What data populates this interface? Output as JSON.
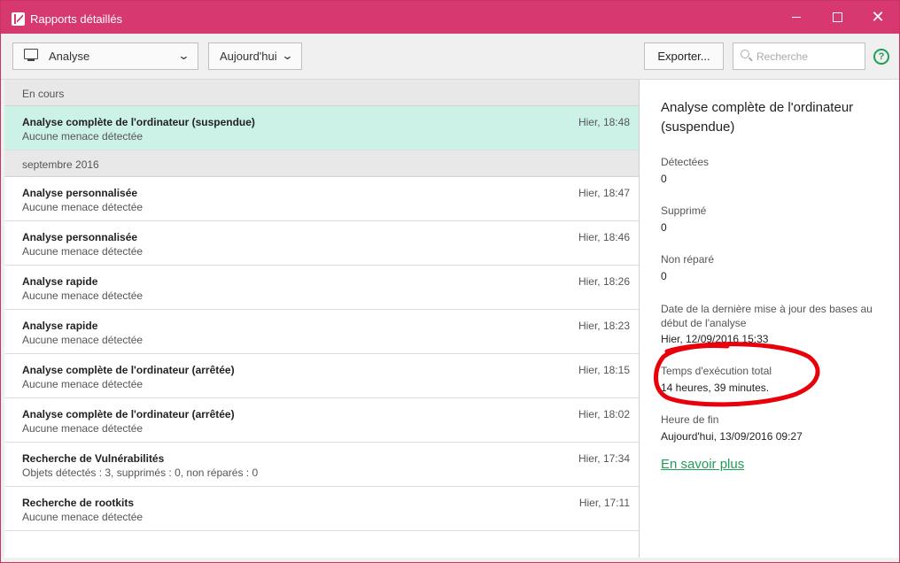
{
  "window": {
    "title": "Rapports détaillés"
  },
  "toolbar": {
    "filter_scope": "Analyse",
    "filter_period": "Aujourd'hui",
    "export_label": "Exporter...",
    "search_placeholder": "Recherche"
  },
  "list": {
    "group1": "En cours",
    "group2": "septembre 2016",
    "items": [
      {
        "name": "Analyse complète de l'ordinateur (suspendue)",
        "status": "Aucune menace détectée",
        "time": "Hier, 18:48"
      },
      {
        "name": "Analyse personnalisée",
        "status": "Aucune menace détectée",
        "time": "Hier, 18:47"
      },
      {
        "name": "Analyse personnalisée",
        "status": "Aucune menace détectée",
        "time": "Hier, 18:46"
      },
      {
        "name": "Analyse rapide",
        "status": "Aucune menace détectée",
        "time": "Hier, 18:26"
      },
      {
        "name": "Analyse rapide",
        "status": "Aucune menace détectée",
        "time": "Hier, 18:23"
      },
      {
        "name": "Analyse complète de l'ordinateur (arrêtée)",
        "status": "Aucune menace détectée",
        "time": "Hier, 18:15"
      },
      {
        "name": "Analyse complète de l'ordinateur (arrêtée)",
        "status": "Aucune menace détectée",
        "time": "Hier, 18:02"
      },
      {
        "name": "Recherche de Vulnérabilités",
        "status": "Objets détectés : 3, supprimés : 0, non réparés : 0",
        "time": "Hier, 17:34"
      },
      {
        "name": "Recherche de rootkits",
        "status": "Aucune menace détectée",
        "time": "Hier, 17:11"
      }
    ]
  },
  "details": {
    "title": "Analyse complète de l'ordinateur (suspendue)",
    "detected_label": "Détectées",
    "detected_value": "0",
    "deleted_label": "Supprimé",
    "deleted_value": "0",
    "unrepaired_label": "Non réparé",
    "unrepaired_value": "0",
    "db_update_label": "Date de la dernière mise à jour des bases au début de l'analyse",
    "db_update_value": "Hier, 12/09/2016 15:33",
    "total_time_label": "Temps d'exécution total",
    "total_time_value": "14 heures, 39 minutes.",
    "end_time_label": "Heure de fin",
    "end_time_value": "Aujourd'hui, 13/09/2016 09:27",
    "more_link": "En savoir plus"
  },
  "colors": {
    "titlebar": "#d6386f",
    "selected_row": "#ccf1e7",
    "link": "#1e9e58",
    "annotation": "#e8000b"
  }
}
